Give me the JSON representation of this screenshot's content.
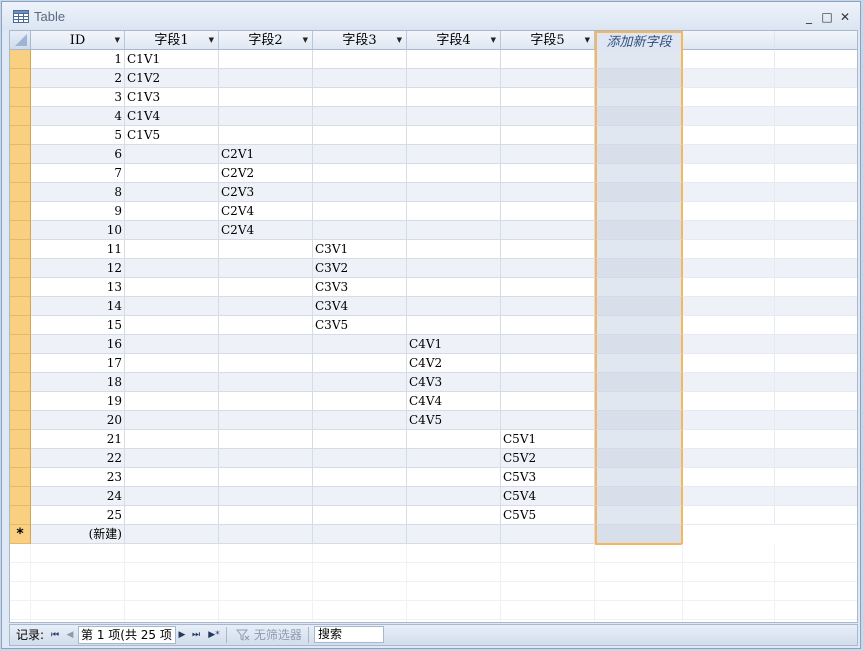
{
  "window": {
    "title": "Table",
    "minimize": "_",
    "maximize": "□",
    "close": "✕"
  },
  "columns": [
    {
      "label": "ID"
    },
    {
      "label": "字段1"
    },
    {
      "label": "字段2"
    },
    {
      "label": "字段3"
    },
    {
      "label": "字段4"
    },
    {
      "label": "字段5"
    }
  ],
  "add_field_label": "添加新字段",
  "rows": [
    {
      "id": "1",
      "f1": "C1V1",
      "f2": "",
      "f3": "",
      "f4": "",
      "f5": ""
    },
    {
      "id": "2",
      "f1": "C1V2",
      "f2": "",
      "f3": "",
      "f4": "",
      "f5": ""
    },
    {
      "id": "3",
      "f1": "C1V3",
      "f2": "",
      "f3": "",
      "f4": "",
      "f5": ""
    },
    {
      "id": "4",
      "f1": "C1V4",
      "f2": "",
      "f3": "",
      "f4": "",
      "f5": ""
    },
    {
      "id": "5",
      "f1": "C1V5",
      "f2": "",
      "f3": "",
      "f4": "",
      "f5": ""
    },
    {
      "id": "6",
      "f1": "",
      "f2": "C2V1",
      "f3": "",
      "f4": "",
      "f5": ""
    },
    {
      "id": "7",
      "f1": "",
      "f2": "C2V2",
      "f3": "",
      "f4": "",
      "f5": ""
    },
    {
      "id": "8",
      "f1": "",
      "f2": "C2V3",
      "f3": "",
      "f4": "",
      "f5": ""
    },
    {
      "id": "9",
      "f1": "",
      "f2": "C2V4",
      "f3": "",
      "f4": "",
      "f5": ""
    },
    {
      "id": "10",
      "f1": "",
      "f2": "C2V4",
      "f3": "",
      "f4": "",
      "f5": ""
    },
    {
      "id": "11",
      "f1": "",
      "f2": "",
      "f3": "C3V1",
      "f4": "",
      "f5": ""
    },
    {
      "id": "12",
      "f1": "",
      "f2": "",
      "f3": "C3V2",
      "f4": "",
      "f5": ""
    },
    {
      "id": "13",
      "f1": "",
      "f2": "",
      "f3": "C3V3",
      "f4": "",
      "f5": ""
    },
    {
      "id": "14",
      "f1": "",
      "f2": "",
      "f3": "C3V4",
      "f4": "",
      "f5": ""
    },
    {
      "id": "15",
      "f1": "",
      "f2": "",
      "f3": "C3V5",
      "f4": "",
      "f5": ""
    },
    {
      "id": "16",
      "f1": "",
      "f2": "",
      "f3": "",
      "f4": "C4V1",
      "f5": ""
    },
    {
      "id": "17",
      "f1": "",
      "f2": "",
      "f3": "",
      "f4": "C4V2",
      "f5": ""
    },
    {
      "id": "18",
      "f1": "",
      "f2": "",
      "f3": "",
      "f4": "C4V3",
      "f5": ""
    },
    {
      "id": "19",
      "f1": "",
      "f2": "",
      "f3": "",
      "f4": "C4V4",
      "f5": ""
    },
    {
      "id": "20",
      "f1": "",
      "f2": "",
      "f3": "",
      "f4": "C4V5",
      "f5": ""
    },
    {
      "id": "21",
      "f1": "",
      "f2": "",
      "f3": "",
      "f4": "",
      "f5": "C5V1"
    },
    {
      "id": "22",
      "f1": "",
      "f2": "",
      "f3": "",
      "f4": "",
      "f5": "C5V2"
    },
    {
      "id": "23",
      "f1": "",
      "f2": "",
      "f3": "",
      "f4": "",
      "f5": "C5V3"
    },
    {
      "id": "24",
      "f1": "",
      "f2": "",
      "f3": "",
      "f4": "",
      "f5": "C5V4"
    },
    {
      "id": "25",
      "f1": "",
      "f2": "",
      "f3": "",
      "f4": "",
      "f5": "C5V5"
    }
  ],
  "new_row": {
    "marker": "*",
    "label": "(新建)"
  },
  "statusbar": {
    "record_label": "记录:",
    "first": "⏮",
    "prev": "◀",
    "record_text": "第 1 项(共 25 项",
    "next": "▶",
    "last": "⏭",
    "new_record": "▶*",
    "filter_label": "无筛选器",
    "search_label": "搜索"
  }
}
